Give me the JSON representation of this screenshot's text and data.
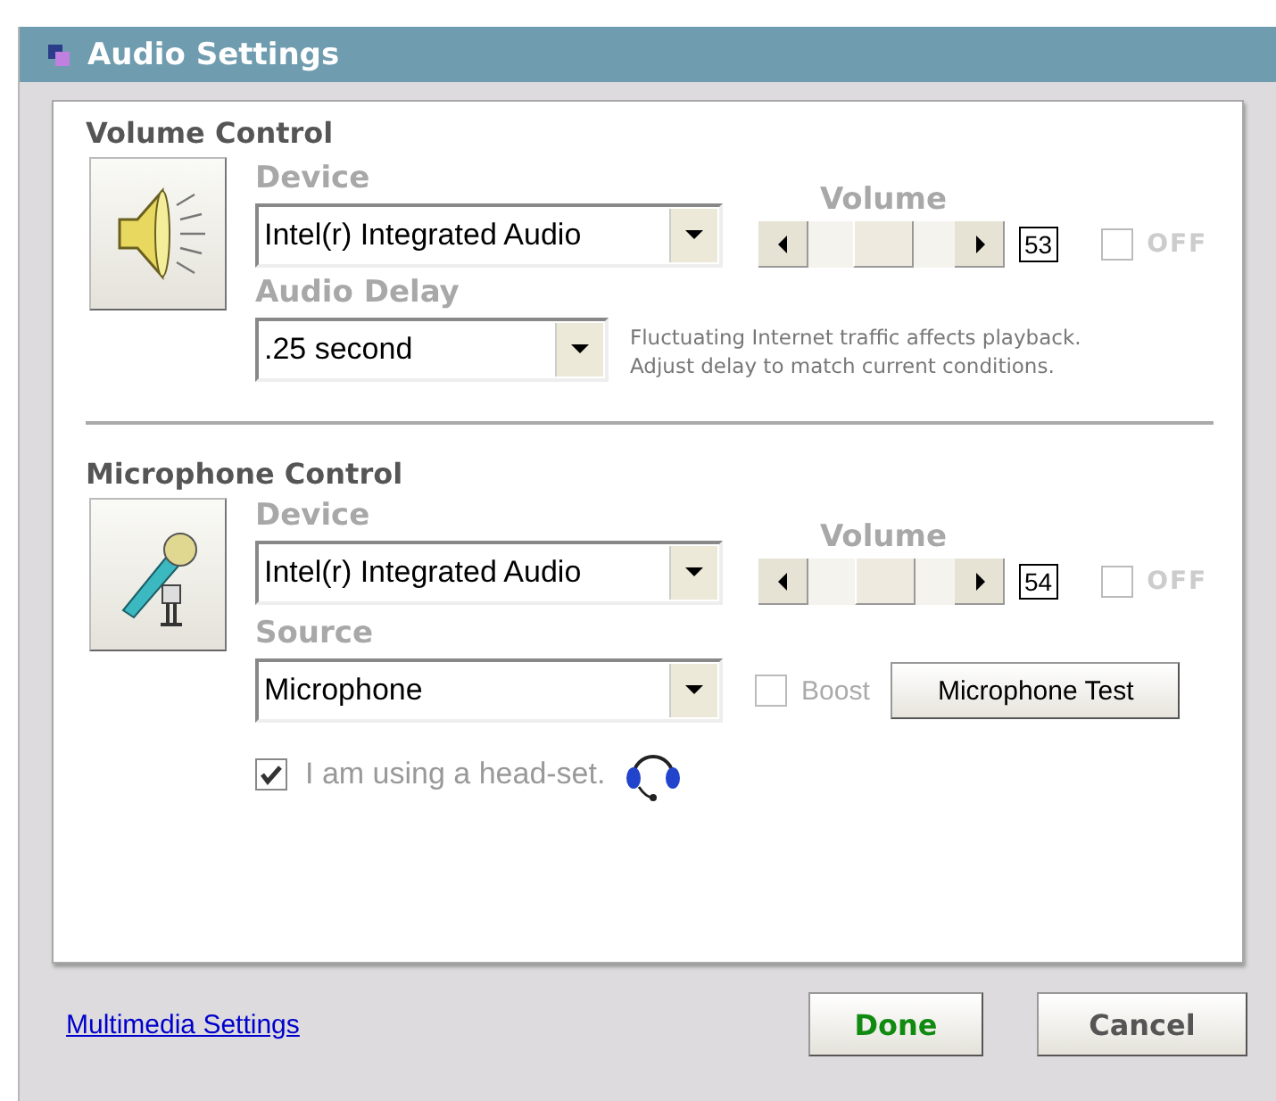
{
  "window": {
    "title": "Audio Settings"
  },
  "volume_control": {
    "title": "Volume Control",
    "device_label": "Device",
    "device_value": "Intel(r) Integrated Audio",
    "volume_label": "Volume",
    "level": 0.53,
    "reading": "53",
    "off": {
      "label": "OFF",
      "checked": false
    },
    "delay_label": "Audio Delay",
    "delay_value": ".25 second",
    "delay_hint": "Fluctuating Internet traffic affects playback.\nAdjust delay to match current conditions."
  },
  "microphone_control": {
    "title": "Microphone Control",
    "device_label": "Device",
    "device_value": "Intel(r) Integrated Audio",
    "volume_label": "Volume",
    "level": 0.54,
    "reading": "54",
    "off": {
      "label": "OFF",
      "checked": false
    },
    "source_label": "Source",
    "source_value": "Microphone",
    "boost": {
      "label": "Boost",
      "checked": false
    },
    "test_button": "Microphone Test",
    "headset": {
      "label": "I am using a head-set.",
      "checked": true
    }
  },
  "footer": {
    "link": "Multimedia Settings",
    "buttons": [
      {
        "label": "Done",
        "kind": "primary"
      },
      {
        "label": "Cancel",
        "kind": "secondary"
      }
    ]
  }
}
